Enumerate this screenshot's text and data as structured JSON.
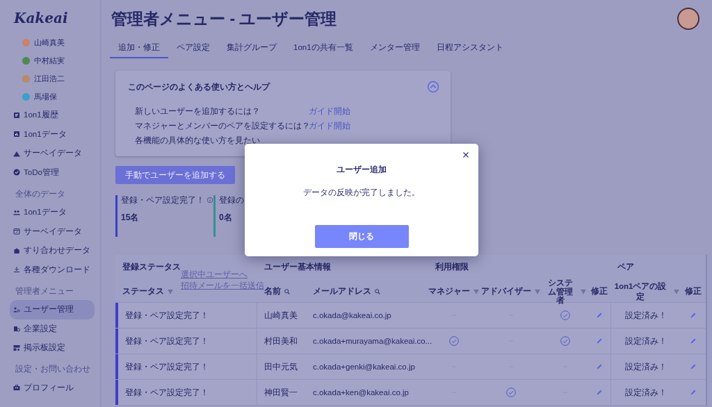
{
  "sidebar": {
    "logo": "Kakeai",
    "members": [
      {
        "name": "山崎真美"
      },
      {
        "name": "中村結実"
      },
      {
        "name": "江田浩二"
      },
      {
        "name": "馬場保"
      }
    ],
    "groups": [
      {
        "items": [
          {
            "label": "1on1履歴",
            "selected": false
          },
          {
            "label": "1on1データ",
            "selected": false
          },
          {
            "label": "サーベイデータ",
            "selected": false
          },
          {
            "label": "ToDo管理",
            "selected": false
          }
        ]
      },
      {
        "heading": "全体のデータ",
        "items": [
          {
            "label": "1on1データ",
            "selected": false
          },
          {
            "label": "サーベイデータ",
            "selected": false
          },
          {
            "label": "すり合わせデータ",
            "selected": false
          },
          {
            "label": "各種ダウンロード",
            "selected": false
          }
        ]
      },
      {
        "heading": "管理者メニュー",
        "items": [
          {
            "label": "ユーザー管理",
            "selected": true
          },
          {
            "label": "企業設定",
            "selected": false
          },
          {
            "label": "掲示板設定",
            "selected": false
          }
        ]
      },
      {
        "heading": "設定・お問い合わせ",
        "items": [
          {
            "label": "プロフィール",
            "selected": false
          }
        ]
      }
    ]
  },
  "page_title": "管理者メニュー - ユーザー管理",
  "tabs": [
    {
      "label": "追加・修正",
      "selected": true
    },
    {
      "label": "ペア設定",
      "selected": false
    },
    {
      "label": "集計グループ",
      "selected": false
    },
    {
      "label": "1on1の共有一覧",
      "selected": false
    },
    {
      "label": "メンター管理",
      "selected": false
    },
    {
      "label": "日程アシスタント",
      "selected": false
    }
  ],
  "help": {
    "title": "このページのよくある使い方とヘルプ",
    "expanded": true,
    "rows": [
      {
        "question": "新しいユーザーを追加するには？",
        "link": "ガイド開始"
      },
      {
        "question": "マネジャーとメンバーのペアを設定するには？",
        "link": "ガイド開始"
      },
      {
        "question": "各機能の具体的な使い方を見たい"
      }
    ]
  },
  "add_button": "手動でユーザーを追加する",
  "stats": [
    {
      "label": "登録・ペア設定完了！",
      "count": "15名",
      "color": "#3c3fc6",
      "info": true
    },
    {
      "label": "登録の",
      "count": "0名",
      "color": "#3a8f92"
    }
  ],
  "table": {
    "groups": [
      "登録ステータス",
      "ユーザー基本情報",
      "利用権限",
      "ペア"
    ],
    "bulk_links": [
      "選択中ユーザーへ",
      "招待メールを一括送信"
    ],
    "columns": [
      {
        "label": "ステータス",
        "kind": "filter"
      },
      {
        "label": "名前",
        "kind": "search"
      },
      {
        "label": "メールアドレス",
        "kind": "search"
      },
      {
        "label": "マネジャー",
        "kind": "filter"
      },
      {
        "label": "アドバイザー",
        "kind": "filter"
      },
      {
        "label": "システム管理者",
        "kind": "filter"
      },
      {
        "label": "修正",
        "kind": "plain"
      },
      {
        "label": "1on1ペアの設定",
        "kind": "filter"
      },
      {
        "label": "修正",
        "kind": "plain"
      }
    ],
    "rows": [
      {
        "status": "登録・ペア設定完了！",
        "name": "山崎真美",
        "email": "c.okada@kakeai.co.jp",
        "manager": false,
        "advisor": false,
        "admin": true,
        "pair": "設定済み！"
      },
      {
        "status": "登録・ペア設定完了！",
        "name": "村田美和",
        "email": "c.okada+murayama@kakeai.co...",
        "manager": true,
        "advisor": false,
        "admin": true,
        "pair": "設定済み！"
      },
      {
        "status": "登録・ペア設定完了！",
        "name": "田中元気",
        "email": "c.okada+genki@kakeai.co.jp",
        "manager": false,
        "advisor": false,
        "admin": false,
        "pair": "設定済み！"
      },
      {
        "status": "登録・ペア設定完了！",
        "name": "神田賢一",
        "email": "c.okada+ken@kakeai.co.jp",
        "manager": false,
        "advisor": true,
        "admin": false,
        "pair": "設定済み！"
      }
    ]
  },
  "modal": {
    "title": "ユーザー追加",
    "message": "データの反映が完了しました。",
    "button": "閉じる"
  }
}
